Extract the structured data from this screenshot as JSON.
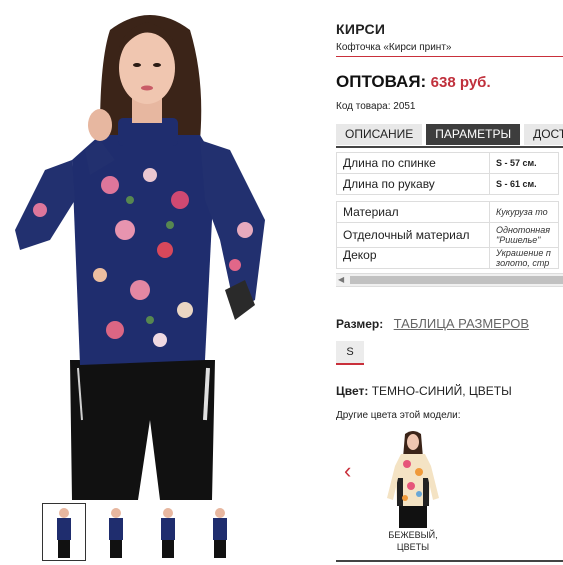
{
  "product": {
    "name": "КИРСИ",
    "subtitle": "Кофточка «Кирси принт»",
    "price_label": "ОПТОВАЯ:",
    "price_value": "638 руб.",
    "sku": "Код товара: 2051"
  },
  "tabs": [
    {
      "label": "ОПИСАНИЕ",
      "active": false
    },
    {
      "label": "ПАРАМЕТРЫ",
      "active": true
    },
    {
      "label": "ДОСТ",
      "active": false
    }
  ],
  "measurements": [
    {
      "name": "Длина по спинке",
      "value": "S - 57 см."
    },
    {
      "name": "Длина по рукаву",
      "value": "S - 61 см."
    }
  ],
  "properties": [
    {
      "name": "Материал",
      "value": "Кукуруза то"
    },
    {
      "name": "Отделочный материал",
      "value": "Однотонная \"Ришелье\""
    },
    {
      "name": "Декор",
      "value": "Украшение п золото, стр"
    }
  ],
  "size": {
    "label": "Размер:",
    "table_link": "ТАБЛИЦА РАЗМЕРОВ",
    "selected": "S"
  },
  "color": {
    "label": "Цвет:",
    "value": "ТЕМНО-СИНИЙ, ЦВЕТЫ",
    "other_label": "Другие цвета этой модели:",
    "variants": [
      {
        "label_line1": "БЕЖЕВЫЙ,",
        "label_line2": "ЦВЕТЫ"
      }
    ]
  },
  "colors": {
    "accent": "#c9303b",
    "price": "#c0303c",
    "tab_active_bg": "#3d3d3d",
    "tab_bg": "#e8e8e8",
    "blouse": "#1f2d6e",
    "trousers": "#111111"
  },
  "icons": {
    "carousel_prev": "chevron-left-icon",
    "scroll_left": "scroll-left-arrow-icon"
  }
}
